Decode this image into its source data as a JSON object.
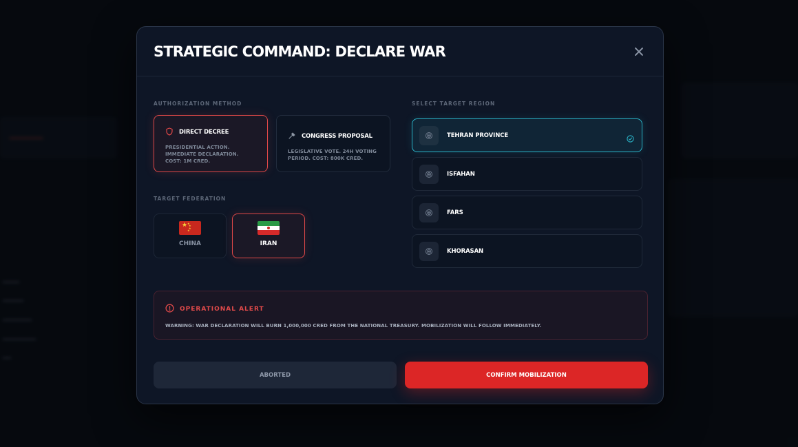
{
  "modal": {
    "title": "STRATEGIC COMMAND: DECLARE WAR"
  },
  "authorization": {
    "label": "AUTHORIZATION METHOD",
    "options": [
      {
        "name": "DIRECT DECREE",
        "desc": "PRESIDENTIAL ACTION. IMMEDIATE DECLARATION. COST: 1M CRED.",
        "selected": true
      },
      {
        "name": "CONGRESS PROPOSAL",
        "desc": "LEGISLATIVE VOTE. 24H VOTING PERIOD. COST: 800K CRED.",
        "selected": false
      }
    ]
  },
  "federation": {
    "label": "TARGET FEDERATION",
    "options": [
      {
        "name": "CHINA",
        "selected": false
      },
      {
        "name": "IRAN",
        "selected": true
      }
    ]
  },
  "regions": {
    "label": "SELECT TARGET REGION",
    "items": [
      {
        "name": "TEHRAN PROVINCE",
        "selected": true
      },
      {
        "name": "ISFAHAN",
        "selected": false
      },
      {
        "name": "FARS",
        "selected": false
      },
      {
        "name": "KHORASAN",
        "selected": false
      }
    ]
  },
  "alert": {
    "title": "OPERATIONAL ALERT",
    "text": "WARNING: WAR DECLARATION WILL BURN 1,000,000 CRED FROM THE NATIONAL TREASURY. MOBILIZATION WILL FOLLOW IMMEDIATELY."
  },
  "actions": {
    "abort_label": "ABORTED",
    "confirm_label": "CONFIRM MOBILIZATION"
  },
  "colors": {
    "accent_red": "#dc2626",
    "accent_cyan": "#2ab4c8",
    "modal_bg": "#0e1626"
  }
}
